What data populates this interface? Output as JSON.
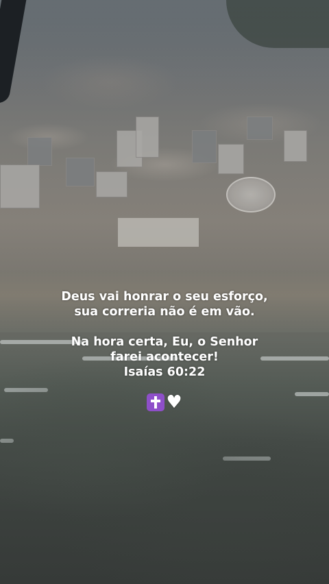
{
  "story": {
    "lines": [
      "Deus vai honrar o seu esforço,",
      "sua correria não é em vão.",
      "",
      "Na hora certa, Eu, o Senhor",
      "farei acontecer!",
      "Isaías 60:22"
    ],
    "emojis": {
      "cross_icon": "latin-cross-emoji-icon",
      "heart_icon": "white-heart-emoji-icon",
      "heart_glyph": "♥"
    },
    "colors": {
      "text": "#ffffff",
      "cross_box": "#8e4fc9"
    }
  }
}
